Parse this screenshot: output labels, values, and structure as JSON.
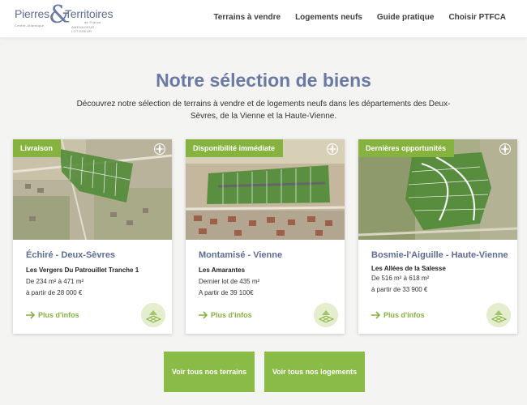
{
  "header": {
    "logo": {
      "word_left": "Pierres",
      "ampersand": "&",
      "word_right": "Territoires",
      "tag_left": "Centre-Atlantique",
      "tag_right_top": "de France",
      "tag_right_bottom": "AMÉNAGEUR · LOTISSEUR"
    },
    "nav": [
      {
        "label": "Terrains à vendre"
      },
      {
        "label": "Logements neufs"
      },
      {
        "label": "Guide pratique"
      },
      {
        "label": "Choisir PTFCA"
      }
    ]
  },
  "hero": {
    "title": "Notre sélection de biens",
    "subtitle": "Découvrez notre sélection de terrains à vendre et de logements neufs dans les départements des Deux-Sèvres, de la Vienne et la Haute-Vienne."
  },
  "cards": [
    {
      "badge": "Livraison",
      "title": "Échiré - Deux-Sèvres",
      "subtitle": "Les Vergers Du Patrouillet Tranche 1",
      "line1": "De 234 m² à 471 m²",
      "line2": "à partir de 28 000 €",
      "more_label": "Plus d'infos"
    },
    {
      "badge": "Disponibilité immédiate",
      "title": "Montamisé - Vienne",
      "subtitle": "Les Amarantes",
      "line1": "Dernier lot de 435 m²",
      "line2": "A partir de 39 100€",
      "more_label": "Plus d'infos"
    },
    {
      "badge": "Dernières opportunités",
      "title": "Bosmie-l'Aiguille - Haute-Vienne",
      "subtitle": "Les Allées de la Salesse",
      "line1": "De 516 m² à 618 m²",
      "line2": "à partir de 33 900 €",
      "more_label": "Plus d'infos"
    }
  ],
  "buttons": {
    "terrains": "Voir tous nos terrains",
    "logements": "Voir tous nos logements"
  },
  "colors": {
    "brand_blue": "#6a79a6",
    "accent_green": "#86b240",
    "button_green": "#8bbb47"
  },
  "icons": [
    "compass-icon",
    "arrow-right-icon",
    "land-plot-icon"
  ]
}
